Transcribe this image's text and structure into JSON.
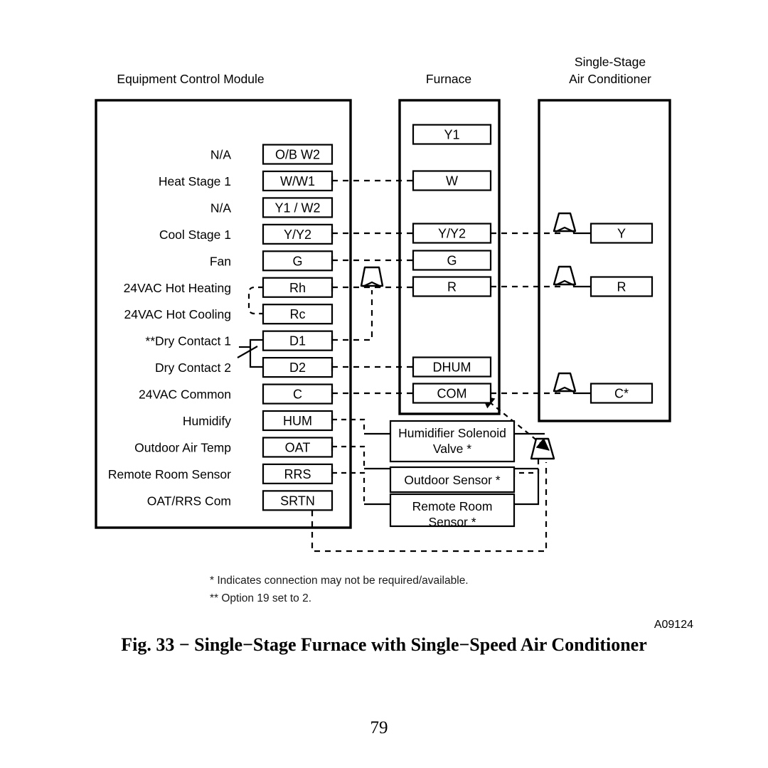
{
  "figure": {
    "caption": "Fig. 33 − Single−Stage Furnace with Single−Speed Air Conditioner",
    "drawing_code": "A09124",
    "page_number": "79"
  },
  "headers": {
    "ecm": "Equipment Control Module",
    "furnace": "Furnace",
    "ac_line1": "Single-Stage",
    "ac_line2": "Air Conditioner"
  },
  "ecm": {
    "rows": [
      {
        "label": "N/A",
        "terminal": "O/B W2"
      },
      {
        "label": "Heat Stage 1",
        "terminal": "W/W1"
      },
      {
        "label": "N/A",
        "terminal": "Y1 / W2"
      },
      {
        "label": "Cool Stage 1",
        "terminal": "Y/Y2"
      },
      {
        "label": "Fan",
        "terminal": "G"
      },
      {
        "label": "24VAC Hot Heating",
        "terminal": "Rh"
      },
      {
        "label": "24VAC Hot Cooling",
        "terminal": "Rc"
      },
      {
        "label": "**Dry Contact 1",
        "terminal": "D1"
      },
      {
        "label": "Dry Contact 2",
        "terminal": "D2"
      },
      {
        "label": "24VAC Common",
        "terminal": "C"
      },
      {
        "label": "Humidify",
        "terminal": "HUM"
      },
      {
        "label": "Outdoor Air Temp",
        "terminal": "OAT"
      },
      {
        "label": "Remote Room Sensor",
        "terminal": "RRS"
      },
      {
        "label": "OAT/RRS Com",
        "terminal": "SRTN"
      }
    ]
  },
  "furnace": {
    "terminals": [
      "Y1",
      "W",
      "Y/Y2",
      "G",
      "R",
      "DHUM",
      "COM"
    ]
  },
  "air_conditioner": {
    "terminals": [
      "Y",
      "R",
      "C*"
    ]
  },
  "accessories": [
    {
      "line1": "Humidifier Solenoid",
      "line2": "Valve  *"
    },
    {
      "line1": "Outdoor Sensor *",
      "line2": ""
    },
    {
      "line1": "Remote Room",
      "line2": "Sensor  *"
    }
  ],
  "notes": {
    "single_star": "*   Indicates connection may not be required/available.",
    "double_star": "** Option 19 set to 2."
  },
  "colors": {
    "ink": "#000000",
    "paper": "#ffffff"
  }
}
